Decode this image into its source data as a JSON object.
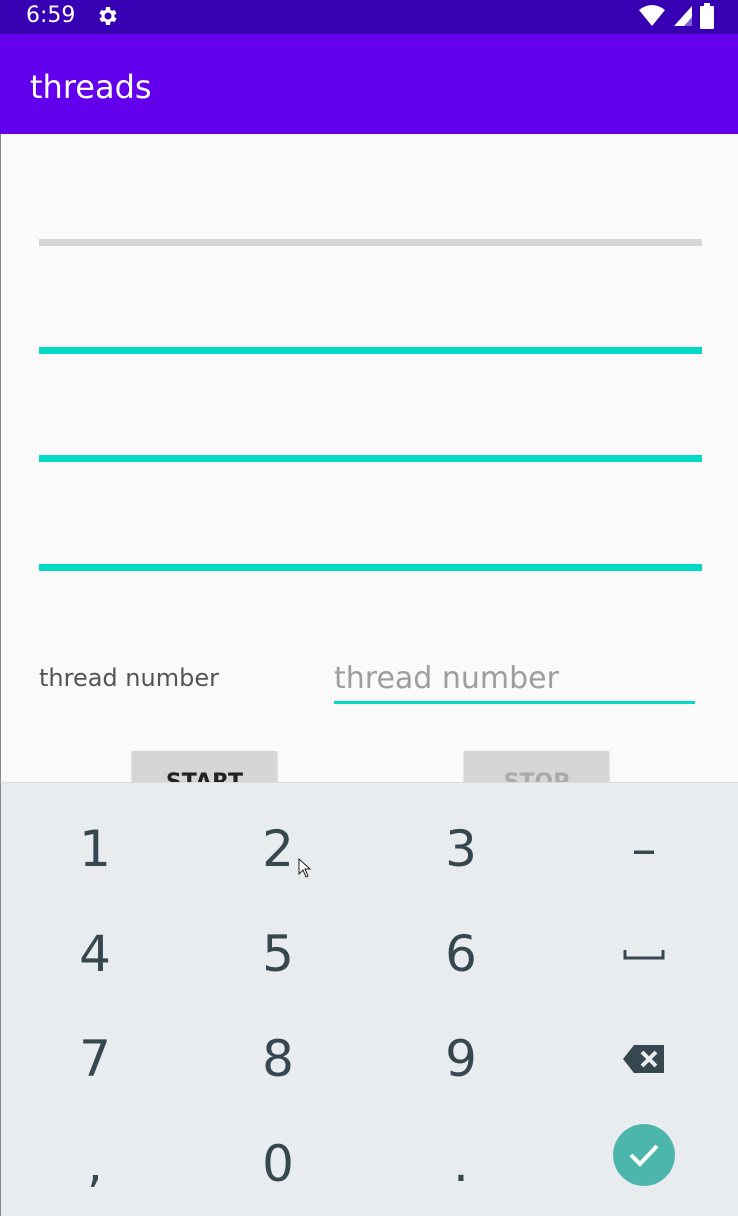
{
  "status_bar": {
    "time": "6:59",
    "icons": [
      "gear-icon",
      "wifi-icon",
      "cell-signal-icon",
      "battery-icon"
    ]
  },
  "app_bar": {
    "title": "threads"
  },
  "progress_bars": [
    {
      "name": "progress-bar-1",
      "fraction": 0.0
    },
    {
      "name": "progress-bar-2",
      "fraction": 1.0
    },
    {
      "name": "progress-bar-3",
      "fraction": 1.0
    },
    {
      "name": "progress-bar-4",
      "fraction": 1.0
    }
  ],
  "form": {
    "label": "thread number",
    "input_value": "",
    "input_placeholder": "thread number"
  },
  "buttons": {
    "start": "START",
    "stop": "STOP"
  },
  "keyboard": {
    "keys": [
      "1",
      "2",
      "3",
      "–",
      "4",
      "5",
      "6",
      "space-icon",
      "7",
      "8",
      "9",
      "backspace-icon",
      ",",
      "0",
      ".",
      "enter-icon"
    ],
    "colors": {
      "background": "#e8ecef",
      "key_text": "#37474f",
      "enter": "#4db6ac"
    }
  },
  "colors": {
    "status_bar": "#3700b3",
    "app_bar": "#6200ee",
    "accent": "#03dac5",
    "track": "#d6d6d6"
  }
}
